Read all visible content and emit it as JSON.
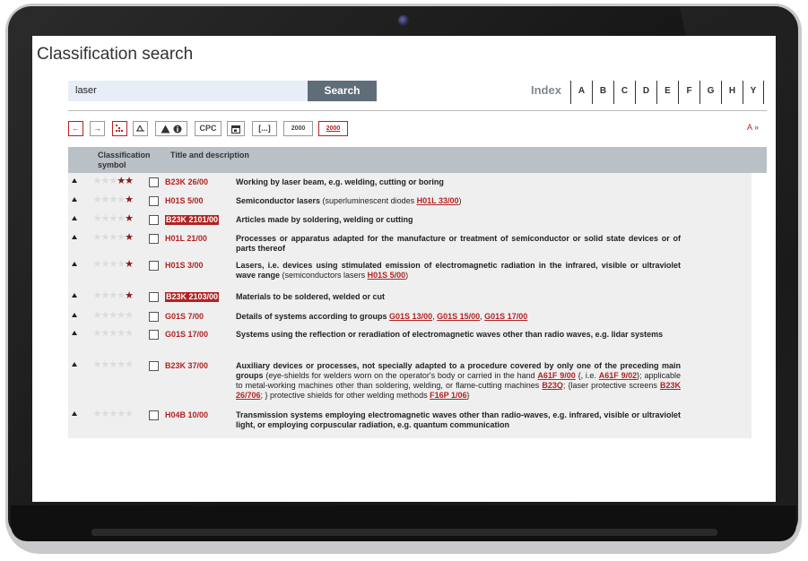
{
  "page": {
    "title": "Classification search"
  },
  "search": {
    "value": "laser",
    "button_label": "Search"
  },
  "index": {
    "label": "Index",
    "letters": [
      "A",
      "B",
      "C",
      "D",
      "E",
      "F",
      "G",
      "H",
      "Y"
    ]
  },
  "toolbar": {
    "back_glyph": "←",
    "forward_glyph": "→",
    "cpc_label": "CPC",
    "ellipsis_label": "[...]",
    "version_old_label": "2000",
    "version_new_label": "2000",
    "a_more_label": "A »"
  },
  "table": {
    "headers": {
      "symbol_line1": "Classification",
      "symbol_line2": "symbol",
      "title": "Title and description"
    },
    "rows": [
      {
        "stars": 2,
        "symbol": "B23K 26/00",
        "highlighted": false,
        "title": "Working by laser beam, e.g. welding, cutting or boring",
        "note_before": "",
        "links": [],
        "note_after": ""
      },
      {
        "stars": 1,
        "symbol": "H01S 5/00",
        "highlighted": false,
        "title": "Semiconductor lasers",
        "note_before": " (superluminescent diodes ",
        "links": [
          "H01L 33/00"
        ],
        "note_after": ")"
      },
      {
        "stars": 1,
        "symbol": "B23K 2101/00",
        "highlighted": true,
        "title": "Articles made by soldering, welding or cutting",
        "note_before": "",
        "links": [],
        "note_after": ""
      },
      {
        "stars": 1,
        "symbol": "H01L 21/00",
        "highlighted": false,
        "title": "Processes or apparatus adapted for the manufacture or treatment of semiconductor or solid state devices or of parts thereof",
        "note_before": "",
        "links": [],
        "note_after": ""
      },
      {
        "stars": 1,
        "symbol": "H01S 3/00",
        "highlighted": false,
        "title": "Lasers, i.e. devices using stimulated emission of electromagnetic radiation in the infrared, visible or ultraviolet wave range",
        "note_before": " (semiconductors lasers ",
        "links": [
          "H01S 5/00"
        ],
        "note_after": ")"
      },
      {
        "stars": 1,
        "symbol": "B23K 2103/00",
        "highlighted": true,
        "title": "Materials to be soldered, welded or cut",
        "note_before": "",
        "links": [],
        "note_after": ""
      },
      {
        "stars": 0,
        "symbol": "G01S 7/00",
        "highlighted": false,
        "title": "Details of systems according to groups ",
        "links": [
          "G01S 13/00",
          "G01S 15/00",
          "G01S 17/00"
        ]
      },
      {
        "stars": 0,
        "symbol": "G01S 17/00",
        "highlighted": false,
        "title": "Systems using the reflection or reradiation of electromagnetic waves other than radio waves, e.g. lidar systems",
        "note_before": "",
        "links": [],
        "note_after": ""
      },
      {
        "stars": 0,
        "symbol": "B23K 37/00",
        "highlighted": false,
        "title": "Auxiliary devices or processes, not specially adapted to a procedure covered by only one of the preceding main groups",
        "segments": [
          " (eye-shields for welders worn on the operator's body or carried in the hand ",
          "A61F 9/00",
          " {, i.e. ",
          "A61F 9/02",
          "}; applicable to metal-working machines other than soldering, welding, or flame-cutting machines ",
          "B23Q",
          "; {laser protective screens ",
          "B23K 26/706",
          "; } protective shields for other welding methods ",
          "F16P 1/06",
          "}"
        ]
      },
      {
        "stars": 0,
        "symbol": "H04B 10/00",
        "highlighted": false,
        "title": "Transmission systems employing electromagnetic waves other than radio-waves, e.g. infrared, visible or ultraviolet light, or employing corpuscular radiation, e.g. quantum communication",
        "note_before": "",
        "links": [],
        "note_after": ""
      }
    ]
  }
}
